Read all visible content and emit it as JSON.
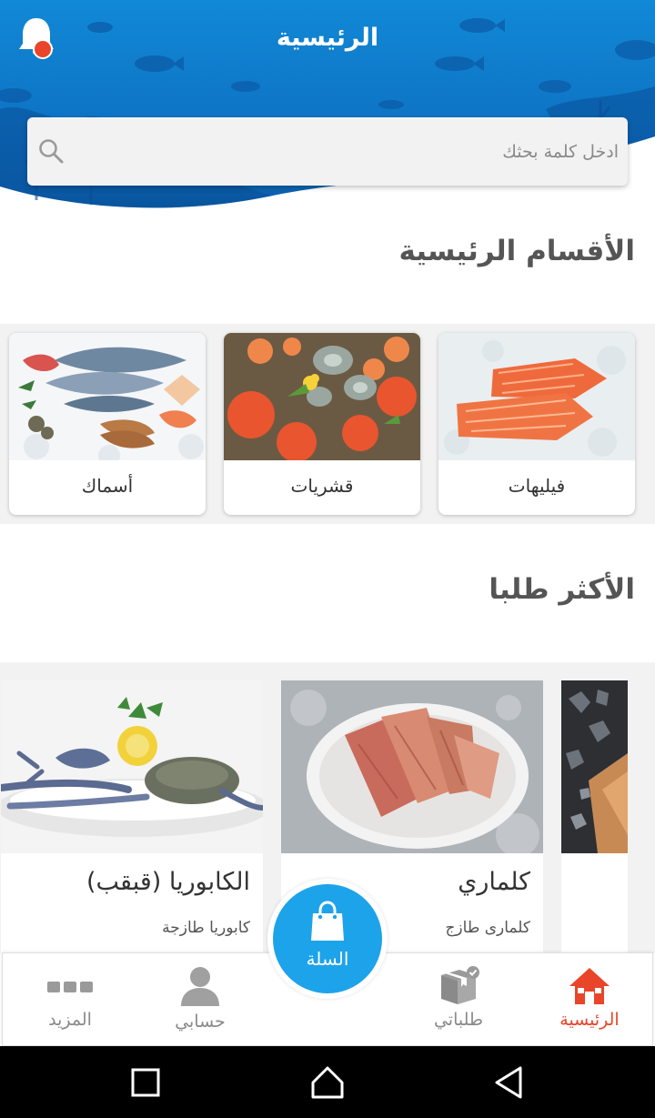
{
  "header": {
    "title": "الرئيسية",
    "notification_icon": "bell-icon",
    "notification_dot_color": "#e8452a"
  },
  "search": {
    "placeholder": "ادخل كلمة بحثك",
    "icon": "search-icon"
  },
  "categories_section": {
    "title": "الأقسام الرئيسية",
    "items": [
      {
        "label": "فيليهات",
        "image": "salmon-fillets-image"
      },
      {
        "label": "قشريات",
        "image": "shellfish-platter-image"
      },
      {
        "label": "أسماك",
        "image": "assorted-fish-image"
      }
    ]
  },
  "popular_section": {
    "title": "الأكثر طلبا",
    "items": [
      {
        "name": "كلماري",
        "subtitle": "كلمارى طازج",
        "image": "calamari-plate-image"
      },
      {
        "name": "الكابوريا (قبقب)",
        "subtitle": "كابوريا طازجة",
        "image": "crab-plate-image"
      }
    ]
  },
  "bottom_nav": {
    "items": [
      {
        "label": "الرئيسية",
        "icon": "home-icon",
        "active": true
      },
      {
        "label": "طلباتي",
        "icon": "orders-box-icon",
        "active": false
      },
      {
        "label": "حسابي",
        "icon": "user-icon",
        "active": false
      },
      {
        "label": "المزيد",
        "icon": "more-dots-icon",
        "active": false
      }
    ],
    "cart": {
      "label": "السلة",
      "icon": "shopping-bag-icon"
    },
    "active_color": "#e8452a",
    "inactive_color": "#8a8a8a",
    "accent_color": "#1da3ea"
  },
  "system_bar": {
    "buttons": [
      "recents-square-icon",
      "home-circle-icon",
      "back-triangle-icon"
    ]
  }
}
